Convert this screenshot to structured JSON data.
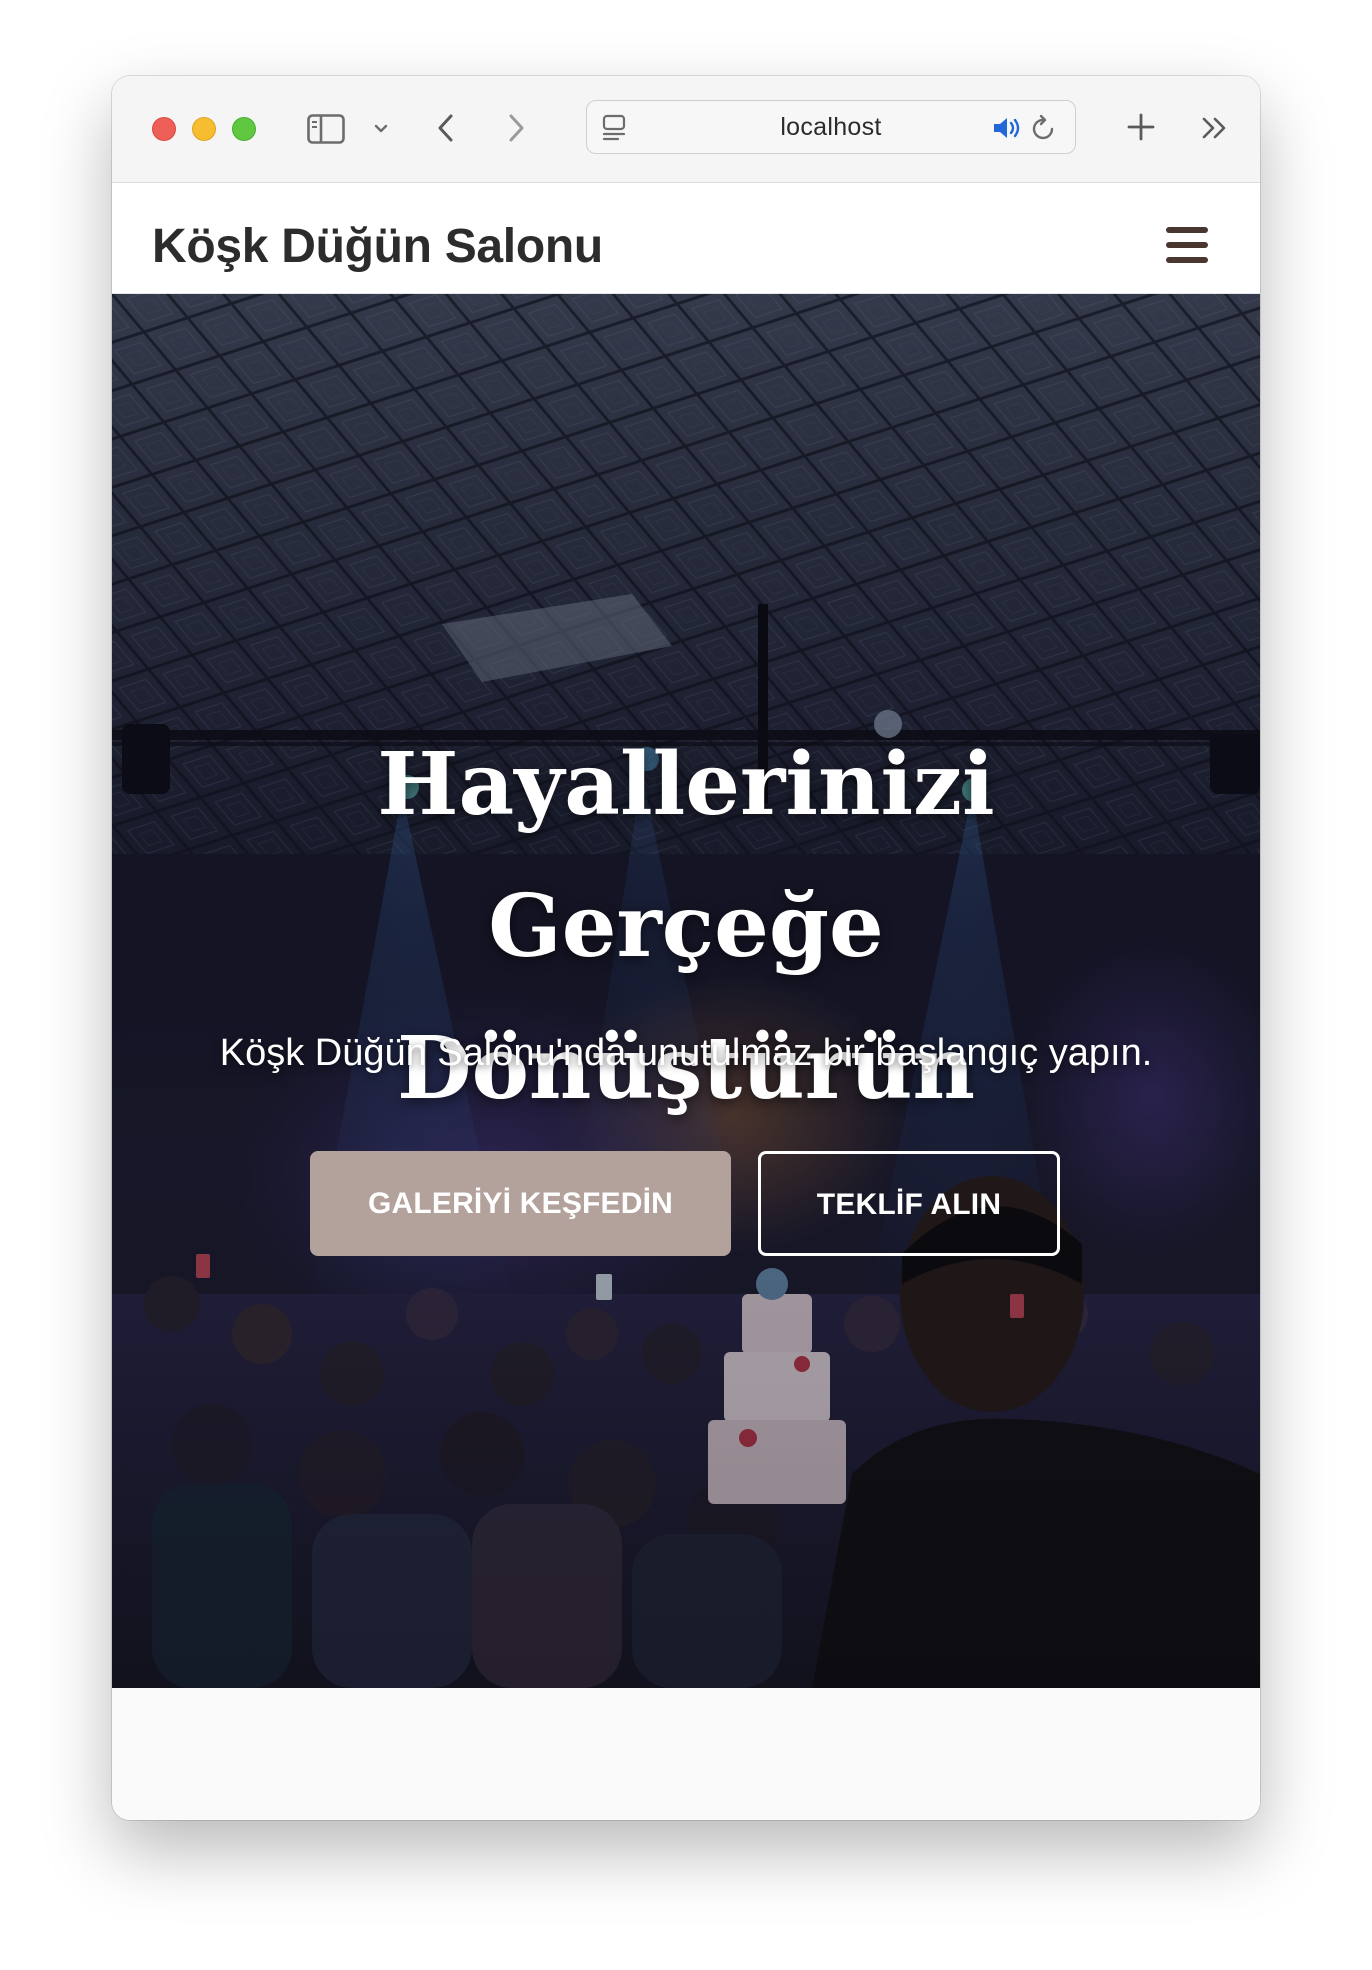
{
  "browser": {
    "url": "localhost"
  },
  "site": {
    "brand": "Köşk Düğün Salonu"
  },
  "hero": {
    "title": "Hayallerinizi Gerçeğe Dönüştürün",
    "subtitle": "Köşk Düğün Salonu'nda unutulmaz bir başlangıç yapın.",
    "primary_button": "GALERİYİ KEŞFEDİN",
    "secondary_button": "TEKLİF ALIN"
  },
  "colors": {
    "primary_button_bg": "#b3a19c",
    "hamburger": "#4a3630",
    "brand_text": "#2c2c2c"
  },
  "icons": [
    "sidebar-icon",
    "chevron-down-icon",
    "back-icon",
    "forward-icon",
    "page-icon",
    "speaker-icon",
    "reload-icon",
    "new-tab-icon",
    "overflow-icon",
    "hamburger-icon"
  ]
}
